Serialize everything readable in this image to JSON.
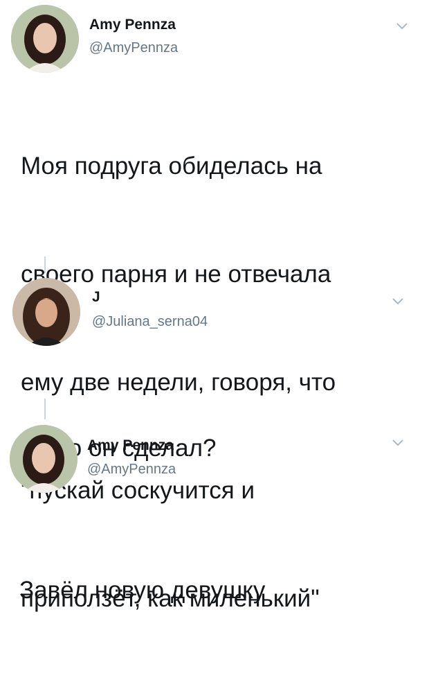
{
  "tweets": [
    {
      "display_name": "Amy Pennza",
      "handle": "@AmyPennza",
      "avatar": "avatar-woman-dark-hair",
      "text_lines": [
        "Моя подруга обиделась на",
        "своего парня и не отвечала",
        "ему две недели, говоря, что",
        "\"пускай соскучится и",
        "приползёт, как миленький\""
      ]
    },
    {
      "display_name": "J",
      "handle": "@Juliana_serna04",
      "avatar": "avatar-woman-long-hair",
      "text_lines": [
        "И что он сделал?"
      ]
    },
    {
      "display_name": "Amy Pennza",
      "handle": "@AmyPennza",
      "avatar": "avatar-woman-dark-hair",
      "text_lines": [
        "Завёл новую девушку"
      ]
    }
  ],
  "colors": {
    "name": "#14171a",
    "handle": "#657786",
    "thread_line": "#ccd6dd",
    "chevron": "#aab8c2"
  },
  "icons": {
    "menu": "chevron-down-icon"
  }
}
